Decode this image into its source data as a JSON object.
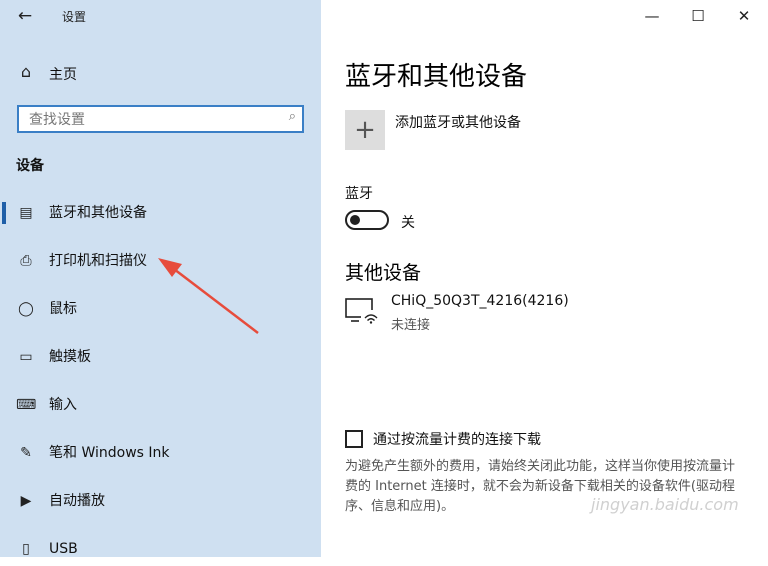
{
  "window": {
    "title": "设置",
    "back_icon": "back-arrow-icon",
    "minimize_icon": "minimize-icon",
    "maximize_icon": "maximize-icon",
    "close_icon": "close-icon"
  },
  "sidebar": {
    "home_label": "主页",
    "home_icon": "home-icon",
    "search_placeholder": "查找设置",
    "search_icon": "search-icon",
    "section_title": "设备",
    "items": [
      {
        "label": "蓝牙和其他设备",
        "icon": "bluetooth-devices-icon",
        "selected": true
      },
      {
        "label": "打印机和扫描仪",
        "icon": "printer-icon",
        "selected": false
      },
      {
        "label": "鼠标",
        "icon": "mouse-icon",
        "selected": false
      },
      {
        "label": "触摸板",
        "icon": "touchpad-icon",
        "selected": false
      },
      {
        "label": "输入",
        "icon": "keyboard-icon",
        "selected": false
      },
      {
        "label": "笔和 Windows Ink",
        "icon": "pen-icon",
        "selected": false
      },
      {
        "label": "自动播放",
        "icon": "autoplay-icon",
        "selected": false
      },
      {
        "label": "USB",
        "icon": "usb-icon",
        "selected": false
      }
    ]
  },
  "main": {
    "heading": "蓝牙和其他设备",
    "add_device_label": "添加蓝牙或其他设备",
    "add_icon": "plus-icon",
    "bluetooth_label": "蓝牙",
    "bluetooth_state": "关",
    "bluetooth_on": false,
    "other_devices_heading": "其他设备",
    "devices": [
      {
        "name": "CHiQ_50Q3T_4216(4216)",
        "status": "未连接",
        "icon": "wireless-display-icon"
      }
    ],
    "metered_checkbox_label": "通过按流量计费的连接下载",
    "metered_checked": false,
    "metered_description": "为避免产生额外的费用，请始终关闭此功能，这样当你使用按流量计费的 Internet 连接时，就不会为新设备下载相关的设备软件(驱动程序、信息和应用)。"
  },
  "watermark": "jingyan.baidu.com",
  "colors": {
    "sidebar_bg": "#cfe0f1",
    "accent": "#1f5fa8",
    "annotation_arrow": "#e74c3c"
  }
}
